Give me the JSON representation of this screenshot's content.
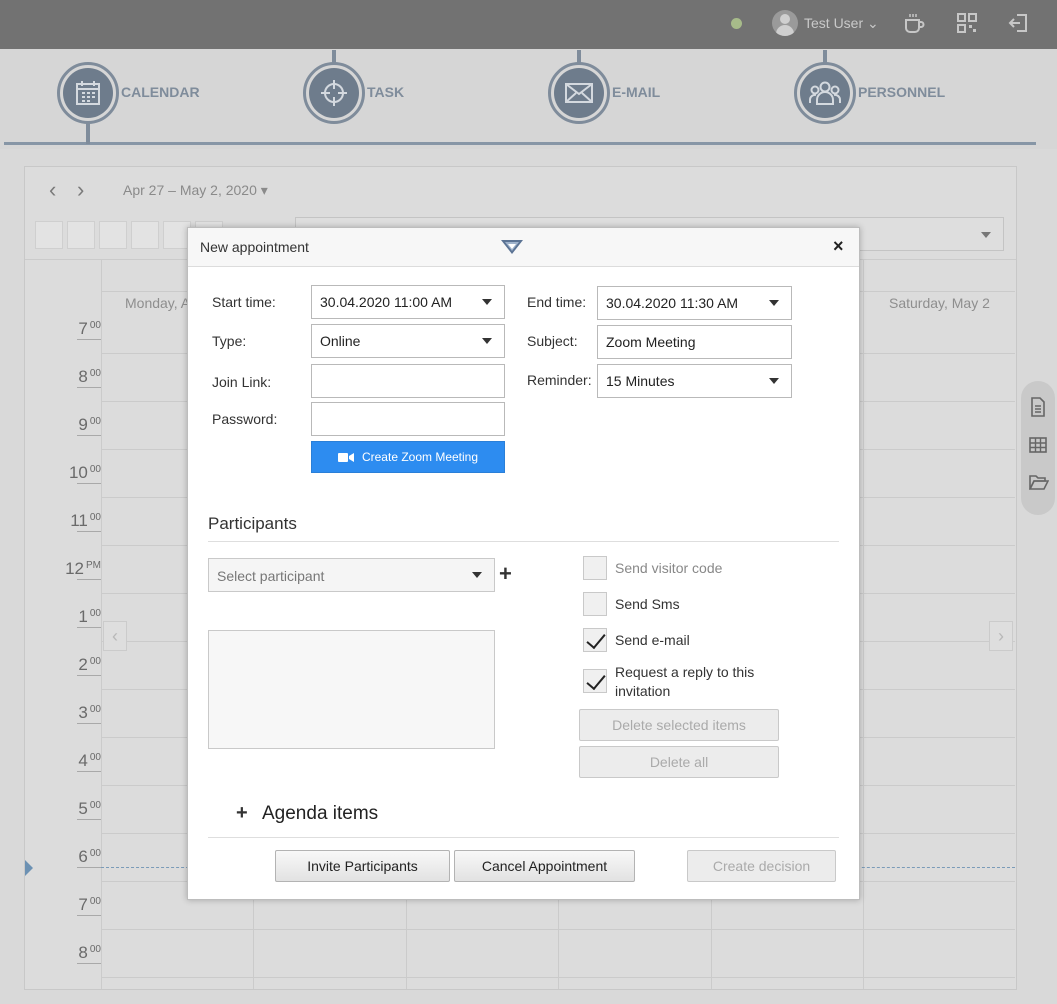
{
  "topbar": {
    "user_name": "Test User ⌄",
    "icons": [
      "status-dot",
      "avatar",
      "coffee-icon",
      "qr-code-icon",
      "logout-icon"
    ]
  },
  "modules": [
    {
      "label": "CALENDAR",
      "icon": "calendar-icon"
    },
    {
      "label": "TASK",
      "icon": "crosshair-icon"
    },
    {
      "label": "E-MAIL",
      "icon": "envelope-icon"
    },
    {
      "label": "PERSONNEL",
      "icon": "people-icon"
    }
  ],
  "calendar": {
    "prev": "‹",
    "next": "›",
    "range": "Apr 27 – May 2, 2020 ▾",
    "day_left": "Monday, A",
    "day_right": "Saturday, May 2",
    "hours": [
      {
        "h": "7",
        "m": "00"
      },
      {
        "h": "8",
        "m": "00"
      },
      {
        "h": "9",
        "m": "00"
      },
      {
        "h": "10",
        "m": "00"
      },
      {
        "h": "11",
        "m": "00"
      },
      {
        "h": "12",
        "m": "PM"
      },
      {
        "h": "1",
        "m": "00"
      },
      {
        "h": "2",
        "m": "00"
      },
      {
        "h": "3",
        "m": "00"
      },
      {
        "h": "4",
        "m": "00"
      },
      {
        "h": "5",
        "m": "00"
      },
      {
        "h": "6",
        "m": "00"
      },
      {
        "h": "7",
        "m": "00"
      },
      {
        "h": "8",
        "m": "00"
      }
    ],
    "left_arrow": "‹",
    "right_arrow": "›"
  },
  "modal": {
    "title": "New appointment",
    "close": "×",
    "start_label": "Start time:",
    "start_value": "30.04.2020 11:00 AM",
    "end_label": "End time:",
    "end_value": "30.04.2020 11:30 AM",
    "type_label": "Type:",
    "type_value": "Online",
    "subject_label": "Subject:",
    "subject_value": "Zoom Meeting",
    "join_label": "Join Link:",
    "join_value": "",
    "reminder_label": "Reminder:",
    "reminder_value": "15 Minutes",
    "password_label": "Password:",
    "password_value": "",
    "zoom_button": "Create Zoom Meeting",
    "participants_title": "Participants",
    "participant_placeholder": "Select participant",
    "add_plus": "+",
    "options": [
      {
        "label": "Send visitor code",
        "checked": false,
        "dim": true
      },
      {
        "label": "Send Sms",
        "checked": false,
        "dim": false
      },
      {
        "label": "Send e-mail",
        "checked": true,
        "dim": false
      },
      {
        "label": "Request a reply to this invitation",
        "checked": true,
        "dim": false
      }
    ],
    "delete_selected": "Delete selected items",
    "delete_all": "Delete all",
    "agenda_plus": "+",
    "agenda_title": "Agenda items",
    "invite_button": "Invite Participants",
    "cancel_button": "Cancel Appointment",
    "decision_button": "Create decision"
  }
}
